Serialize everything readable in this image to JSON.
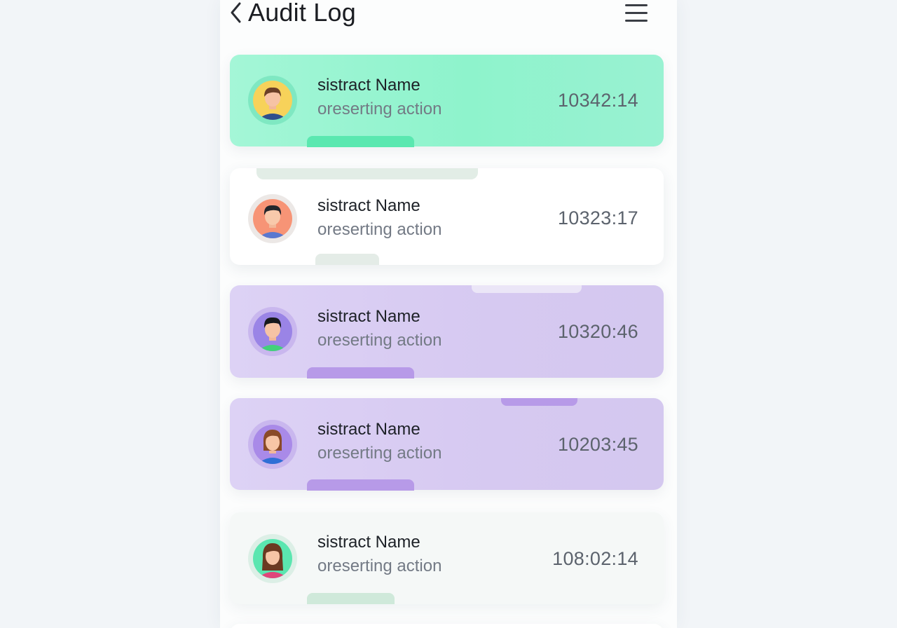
{
  "header": {
    "title": "Audit Log",
    "back_icon": "chevron-left-icon",
    "menu_icon": "hamburger-menu-icon"
  },
  "colors": {
    "green_card": "#8ef3cc",
    "purple_card": "#d6c9f1",
    "white_card": "#ffffff",
    "neutral_card": "#f5f8f7"
  },
  "entries": [
    {
      "name": "sistract Name",
      "action": "oreserting action",
      "time": "10342:14",
      "theme": "green"
    },
    {
      "name": "sistract Name",
      "action": "oreserting action",
      "time": "10323:17",
      "theme": "white"
    },
    {
      "name": "sistract Name",
      "action": "oreserting action",
      "time": "10320:46",
      "theme": "purple"
    },
    {
      "name": "sistract Name",
      "action": "oreserting action",
      "time": "10203:45",
      "theme": "purple"
    },
    {
      "name": "sistract Name",
      "action": "oreserting action",
      "time": "108:02:14",
      "theme": "neutral"
    }
  ]
}
